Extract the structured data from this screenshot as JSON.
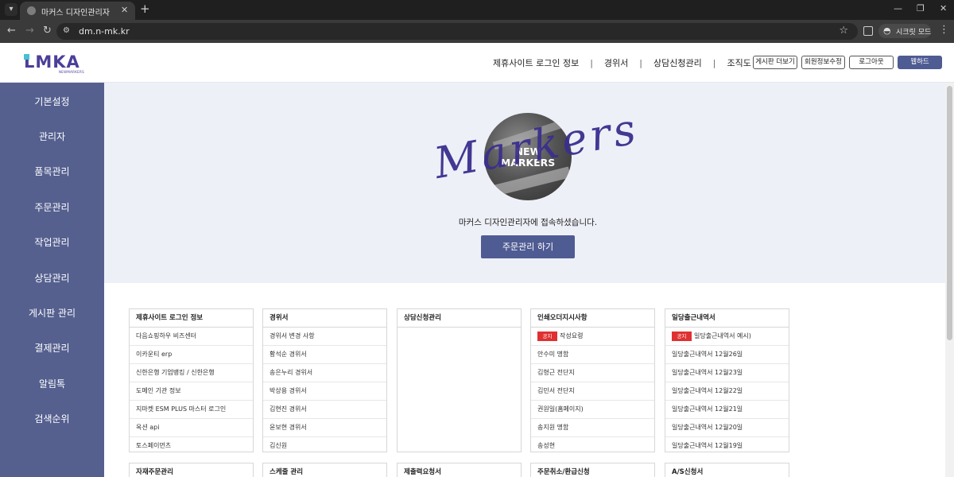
{
  "browser": {
    "tab_title": "마커스 디자인관리자",
    "url": "dm.n-mk.kr",
    "incognito_label": "시크릿 모드"
  },
  "header": {
    "logo_text": "LMKA",
    "logo_sub": "NEWMARKERS",
    "nav": [
      "제휴사이트 로그인 정보",
      "경위서",
      "상담신청관리",
      "조직도"
    ],
    "buttons": [
      "게시판 더보기",
      "회원정보수정",
      "로그아웃",
      "웹하드"
    ]
  },
  "sidebar": {
    "items": [
      "기본설정",
      "관리자",
      "품목관리",
      "주문관리",
      "작업관리",
      "상담관리",
      "게시판 관리",
      "결제관리",
      "알림톡",
      "검색순위"
    ]
  },
  "hero": {
    "script_text": "Markers",
    "title_line1": "NEW",
    "title_line2": "MARKERS",
    "message": "마커스 디자인관리자에 접속하셨습니다.",
    "button": "주문관리 하기"
  },
  "boards": [
    {
      "title": "제휴사이트 로그인 정보",
      "rows": [
        {
          "text": "다음쇼핑하우 비즈센터"
        },
        {
          "text": "이카운티 erp"
        },
        {
          "text": "신한은행 기업뱅킹 / 신한은행"
        },
        {
          "text": "도메인 기관 정보"
        },
        {
          "text": "지마켓 ESM PLUS 마스터 로그인"
        },
        {
          "text": "옥션 api"
        },
        {
          "text": "토스페이먼츠"
        }
      ]
    },
    {
      "title": "경위서",
      "rows": [
        {
          "text": "경위서 변경 사항"
        },
        {
          "text": "황석순 경위서"
        },
        {
          "text": "송은누리 경위서"
        },
        {
          "text": "박상용 경위서"
        },
        {
          "text": "김현진 경위서"
        },
        {
          "text": "윤보현 경위서"
        },
        {
          "text": "김신원"
        }
      ]
    },
    {
      "title": "상담신청관리",
      "rows": []
    },
    {
      "title": "인쇄오더지시사항",
      "rows": [
        {
          "badge": "공지",
          "text": "작성요령"
        },
        {
          "text": "안수미 명함"
        },
        {
          "text": "김형근 전단지"
        },
        {
          "text": "김민서 전단지"
        },
        {
          "text": "권원일(홈페이지)"
        },
        {
          "text": "송지원 명함"
        },
        {
          "text": "송성현"
        }
      ]
    },
    {
      "title": "일당출근내역서",
      "rows": [
        {
          "badge": "공지",
          "text": "일당출근내역서 예시)"
        },
        {
          "text": "일당출근내역서 12월26일"
        },
        {
          "text": "일당출근내역서 12월23일"
        },
        {
          "text": "일당출근내역서 12월22일"
        },
        {
          "text": "일당출근내역서 12월21일"
        },
        {
          "text": "일당출근내역서 12월20일"
        },
        {
          "text": "일당출근내역서 12월19일"
        }
      ]
    },
    {
      "title": "자재주문관리",
      "rows": []
    },
    {
      "title": "스케줄 관리",
      "rows": []
    },
    {
      "title": "제출력요청서",
      "rows": []
    },
    {
      "title": "주문취소/환급신청",
      "rows": []
    },
    {
      "title": "A/S신청서",
      "rows": []
    }
  ]
}
